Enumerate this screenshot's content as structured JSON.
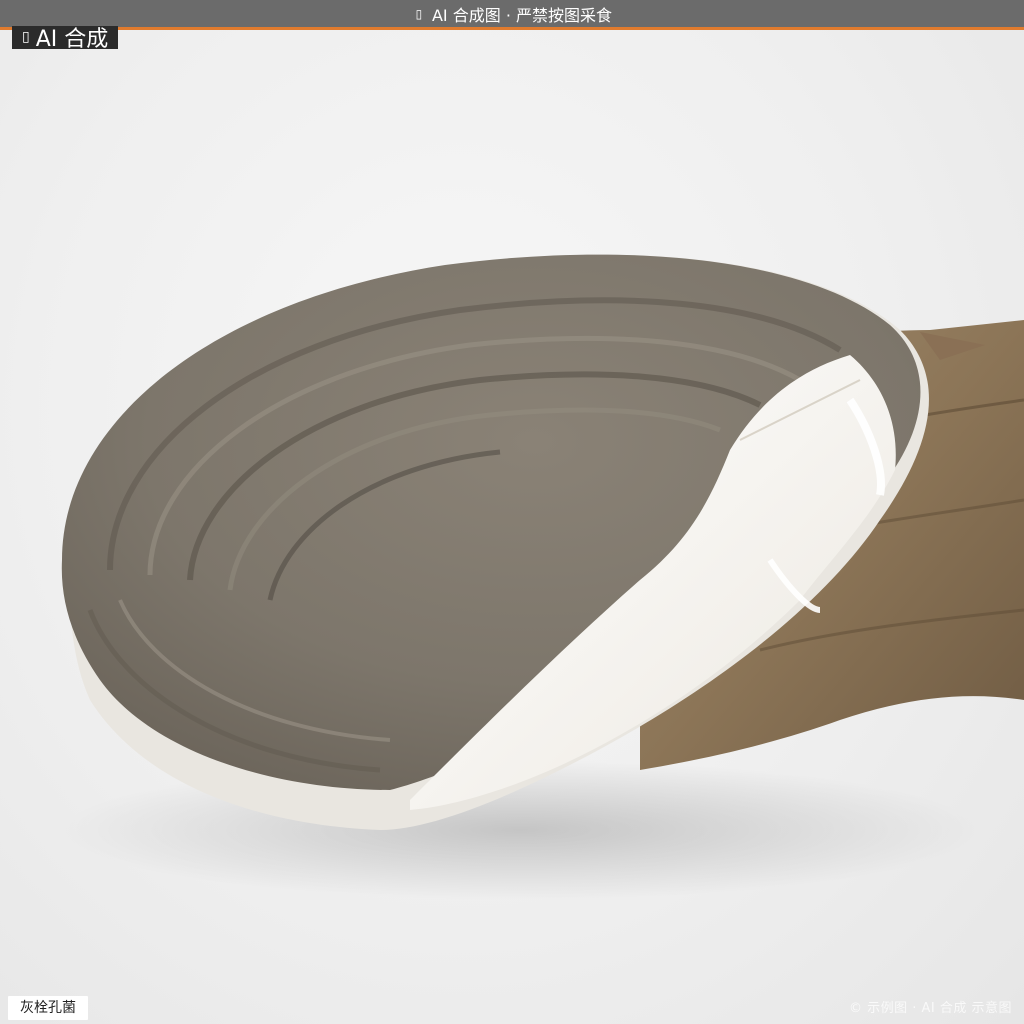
{
  "banner": {
    "icon": "warning-icon",
    "text": "AI 合成图 · 严禁按图采食",
    "background_color": "#6b6b6b",
    "accent_color": "#e07b2e"
  },
  "badge": {
    "icon": "warning-icon",
    "text": "AI 合成"
  },
  "species_label": {
    "text": "灰栓孔菌"
  },
  "watermark": {
    "text": "© 示例图 · AI 合成 示意图"
  }
}
